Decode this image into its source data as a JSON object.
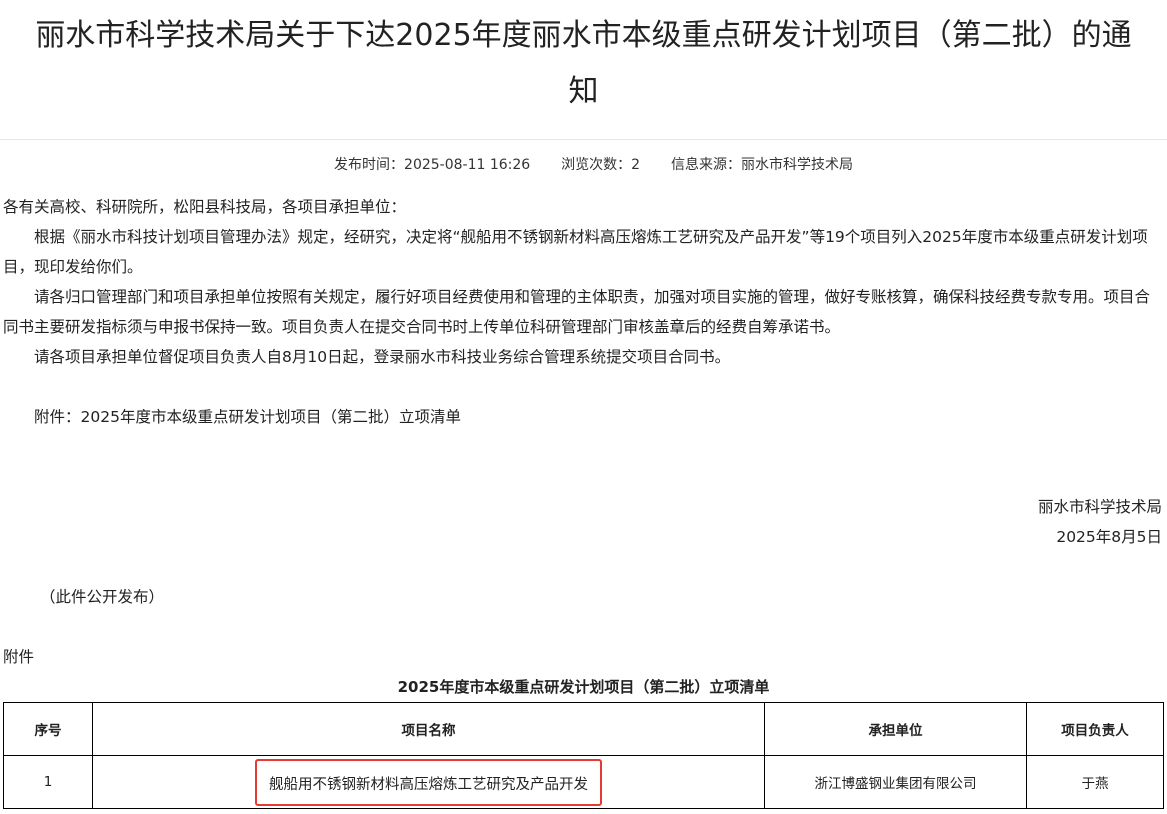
{
  "article": {
    "title_line1": "丽水市科学技术局关于下达2025年度丽水市本级重点研发计划项目（第二批）的通",
    "title_line2": "知",
    "meta": {
      "publish_label": "发布时间：",
      "publish_time": "2025-08-11 16:26",
      "views_label": "浏览次数：",
      "views": "2",
      "source_label": "信息来源：",
      "source": "丽水市科学技术局"
    },
    "salutation": "各有关高校、科研院所，松阳县科技局，各项目承担单位：",
    "paragraphs": [
      "根据《丽水市科技计划项目管理办法》规定，经研究，决定将“舰船用不锈钢新材料高压熔炼工艺研究及产品开发”等19个项目列入2025年度市本级重点研发计划项目，现印发给你们。",
      "请各归口管理部门和项目承担单位按照有关规定，履行好项目经费使用和管理的主体职责，加强对项目实施的管理，做好专账核算，确保科技经费专款专用。项目合同书主要研发指标须与申报书保持一致。项目负责人在提交合同书时上传单位科研管理部门审核盖章后的经费自筹承诺书。",
      "请各项目承担单位督促项目负责人自8月10日起，登录丽水市科技业务综合管理系统提交项目合同书。"
    ],
    "attachment_link": "附件：2025年度市本级重点研发计划项目（第二批）立项清单",
    "signature_org": "丽水市科学技术局",
    "signature_date": "2025年8月5日",
    "public_note": "（此件公开发布）",
    "attachment_label": "附件"
  },
  "table": {
    "title": "2025年度市本级重点研发计划项目（第二批）立项清单",
    "headers": [
      "序号",
      "项目名称",
      "承担单位",
      "项目负责人"
    ],
    "rows": [
      [
        "1",
        "舰船用不锈钢新材料高压熔炼工艺研究及产品开发",
        "浙江博盛钢业集团有限公司",
        "于燕"
      ]
    ]
  },
  "colors": {
    "highlight": "#e53b33"
  }
}
